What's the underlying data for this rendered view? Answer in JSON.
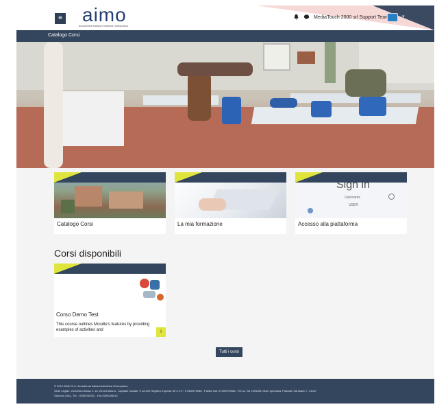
{
  "header": {
    "menu_label": "≡",
    "logo": "aimo",
    "logo_subtitle": "accademia italiana medicina osteopatica",
    "user_name": "MediaTouch 2000 srl Support Team",
    "bell_icon": "bell-icon",
    "chat_icon": "chat-icon",
    "chevron": "▾"
  },
  "breadcrumb": "Catalogo Corsi",
  "cards": [
    {
      "label": "Catalogo Corsi"
    },
    {
      "label": "La mia formazione"
    },
    {
      "label": "Accesso alla piattaforma"
    }
  ],
  "signin": {
    "title": "Sign in",
    "username": "Username",
    "user_value": "USER"
  },
  "section_title": "Corsi disponibili",
  "course": {
    "title": "Corso Demo Test",
    "summary": "This course outlines Moodle's features by providing examples of activities and",
    "info_icon": "i"
  },
  "all_courses_button": "Tutti i corsi",
  "footer": {
    "line1": "© 2019 AIMO S.r.l. Accademia Italiana Medicina Osteopatica",
    "line2": "Sede Legale: via Della Chiusa n. 15, 20123 Milano - Capitale Sociale: € 12.000 Registro Imprese MI e C.F.: 07300970968 - Partita IVA: 07300970968 - R.E.A.: MI 1951351 Sede operativa: Piazzale Santuario 7, 21047",
    "line3": "Saronno (VA) - Tel. : 0296706292 - Fax 0296198412"
  },
  "colors": {
    "navy": "#34465e",
    "accent_yellow": "#dfe53c",
    "logo_blue": "#233f73"
  }
}
